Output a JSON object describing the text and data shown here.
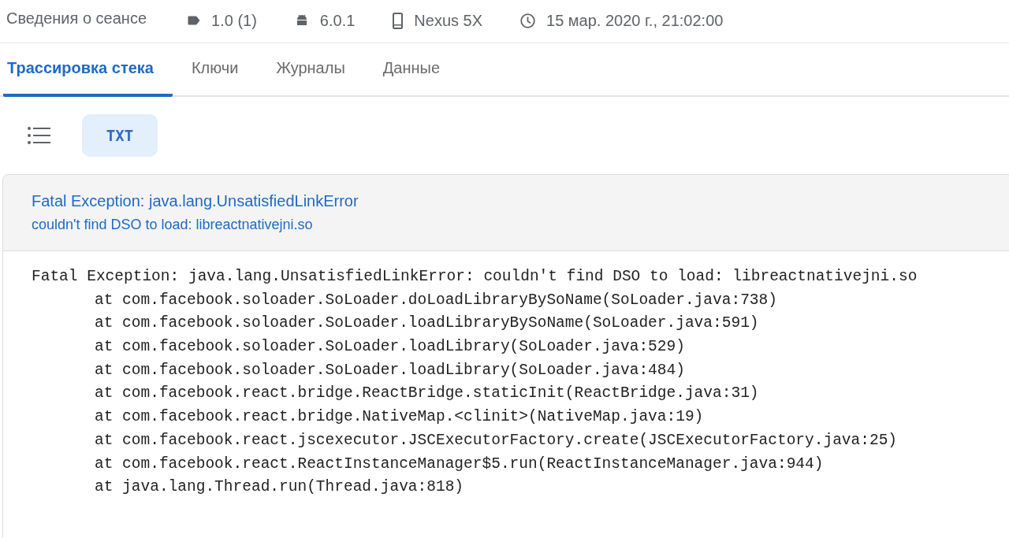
{
  "session": {
    "title": "Сведения о сеансе",
    "items": [
      {
        "kind": "tag",
        "text": "1.0 (1)"
      },
      {
        "kind": "android",
        "text": "6.0.1"
      },
      {
        "kind": "phone",
        "text": "Nexus 5X"
      },
      {
        "kind": "clock",
        "text": "15 мар. 2020 г., 21:02:00"
      }
    ]
  },
  "tabs": [
    {
      "label": "Трассировка стека",
      "selected": true
    },
    {
      "label": "Ключи",
      "selected": false
    },
    {
      "label": "Журналы",
      "selected": false
    },
    {
      "label": "Данные",
      "selected": false
    }
  ],
  "view_modes": [
    {
      "kind": "list",
      "selected": false
    },
    {
      "kind": "text",
      "label": "TXT",
      "selected": true
    }
  ],
  "exception": {
    "title": "Fatal Exception: java.lang.UnsatisfiedLinkError",
    "message": "couldn't find DSO to load: libreactnativejni.so",
    "stack_header": "Fatal Exception: java.lang.UnsatisfiedLinkError: couldn't find DSO to load: libreactnativejni.so",
    "frames": [
      "at com.facebook.soloader.SoLoader.doLoadLibraryBySoName(SoLoader.java:738)",
      "at com.facebook.soloader.SoLoader.loadLibraryBySoName(SoLoader.java:591)",
      "at com.facebook.soloader.SoLoader.loadLibrary(SoLoader.java:529)",
      "at com.facebook.soloader.SoLoader.loadLibrary(SoLoader.java:484)",
      "at com.facebook.react.bridge.ReactBridge.staticInit(ReactBridge.java:31)",
      "at com.facebook.react.bridge.NativeMap.<clinit>(NativeMap.java:19)",
      "at com.facebook.react.jscexecutor.JSCExecutorFactory.create(JSCExecutorFactory.java:25)",
      "at com.facebook.react.ReactInstanceManager$5.run(ReactInstanceManager.java:944)",
      "at java.lang.Thread.run(Thread.java:818)"
    ]
  }
}
